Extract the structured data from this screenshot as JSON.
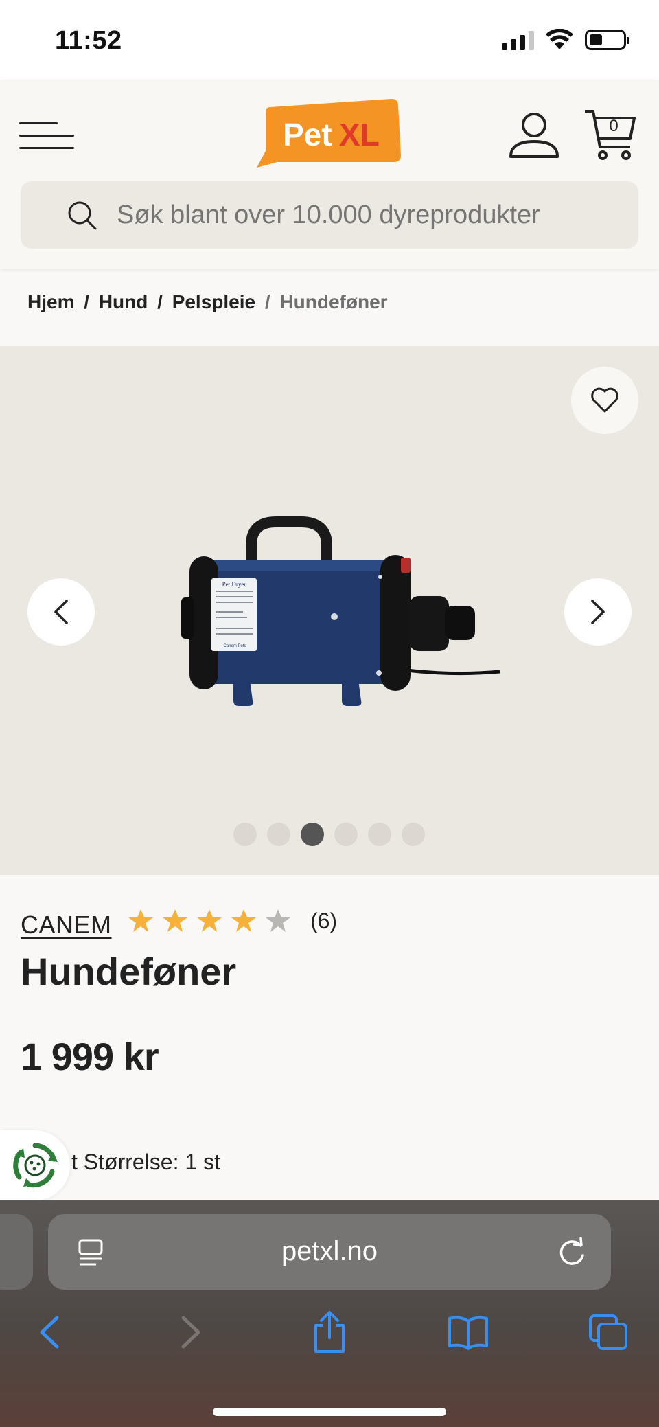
{
  "status_bar": {
    "time": "11:52"
  },
  "header": {
    "logo_text_pet": "Pet",
    "logo_text_xl": "XL",
    "cart_count": "0",
    "search_placeholder": "Søk blant over 10.000 dyreprodukter"
  },
  "breadcrumb": {
    "items": [
      "Hjem",
      "Hund",
      "Pelspleie"
    ],
    "separator": "/",
    "current": "Hundeføner"
  },
  "gallery": {
    "total_images": 6,
    "active_index": 2,
    "label_text": "Pet Dryer",
    "label_brand": "Canem Pets"
  },
  "product": {
    "brand": "CANEM",
    "rating": 4,
    "rating_max": 5,
    "review_count": "(6)",
    "title": "Hundeføner",
    "price": "1 999 kr",
    "size_partial": "t Størrelse: 1 st"
  },
  "browser": {
    "url": "petxl.no"
  },
  "colors": {
    "brand_orange": "#f39424",
    "brand_red": "#e03a2a",
    "star_filled": "#f6b13a",
    "star_empty": "#b9b7b3",
    "safari_blue": "#3a8ef0",
    "eco_green": "#2f7d3a"
  }
}
